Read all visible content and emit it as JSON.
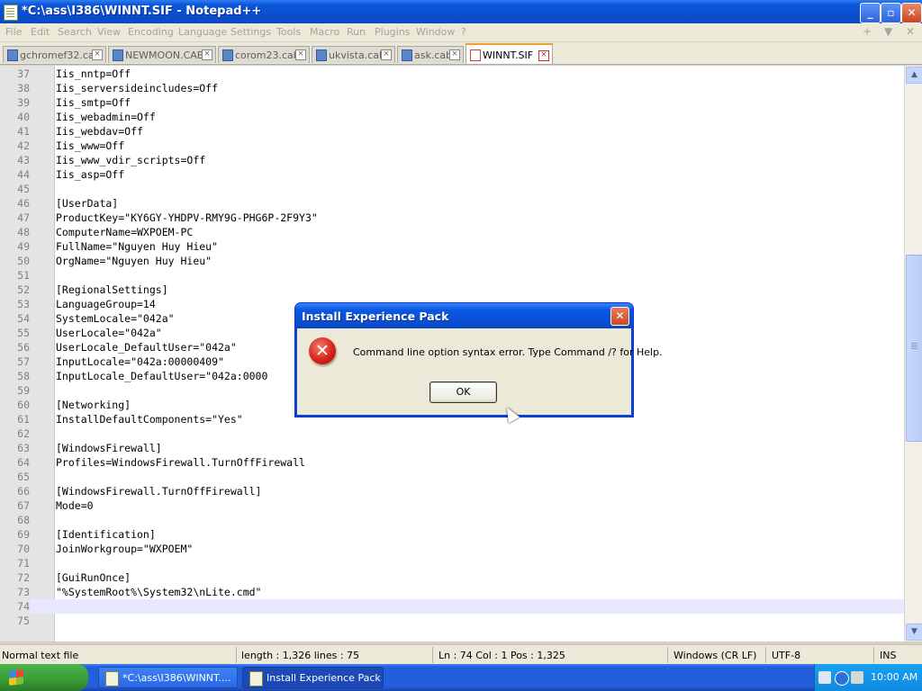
{
  "window": {
    "title": "*C:\\ass\\I386\\WINNT.SIF - Notepad++",
    "controls": {
      "minimize": "_",
      "maximize": "▫",
      "close": "✕"
    }
  },
  "menu": [
    "File",
    "Edit",
    "Search",
    "View",
    "Encoding",
    "Language",
    "Settings",
    "Tools",
    "Macro",
    "Run",
    "Plugins",
    "Window",
    "?"
  ],
  "menu_right": [
    "+",
    "▼",
    "✕"
  ],
  "tabs": [
    {
      "label": "gchromef32.cab",
      "active": false
    },
    {
      "label": "NEWMOON.CAB",
      "active": false
    },
    {
      "label": "corom23.cab",
      "active": false
    },
    {
      "label": "ukvista.cab",
      "active": false
    },
    {
      "label": "ask.cab",
      "active": false
    },
    {
      "label": "WINNT.SIF",
      "active": true
    }
  ],
  "editor": {
    "current_line": 74,
    "lines": [
      {
        "n": "37",
        "t": "Iis_nntp=Off"
      },
      {
        "n": "38",
        "t": "Iis_serversideincludes=Off"
      },
      {
        "n": "39",
        "t": "Iis_smtp=Off"
      },
      {
        "n": "40",
        "t": "Iis_webadmin=Off"
      },
      {
        "n": "41",
        "t": "Iis_webdav=Off"
      },
      {
        "n": "42",
        "t": "Iis_www=Off"
      },
      {
        "n": "43",
        "t": "Iis_www_vdir_scripts=Off"
      },
      {
        "n": "44",
        "t": "Iis_asp=Off"
      },
      {
        "n": "45",
        "t": ""
      },
      {
        "n": "46",
        "t": "[UserData]"
      },
      {
        "n": "47",
        "t": "ProductKey=\"KY6GY-YHDPV-RMY9G-PHG6P-2F9Y3\""
      },
      {
        "n": "48",
        "t": "ComputerName=WXPOEM-PC"
      },
      {
        "n": "49",
        "t": "FullName=\"Nguyen Huy Hieu\""
      },
      {
        "n": "50",
        "t": "OrgName=\"Nguyen Huy Hieu\""
      },
      {
        "n": "51",
        "t": ""
      },
      {
        "n": "52",
        "t": "[RegionalSettings]"
      },
      {
        "n": "53",
        "t": "LanguageGroup=14"
      },
      {
        "n": "54",
        "t": "SystemLocale=\"042a\""
      },
      {
        "n": "55",
        "t": "UserLocale=\"042a\""
      },
      {
        "n": "56",
        "t": "UserLocale_DefaultUser=\"042a\""
      },
      {
        "n": "57",
        "t": "InputLocale=\"042a:00000409\""
      },
      {
        "n": "58",
        "t": "InputLocale_DefaultUser=\"042a:0000"
      },
      {
        "n": "59",
        "t": ""
      },
      {
        "n": "60",
        "t": "[Networking]"
      },
      {
        "n": "61",
        "t": "InstallDefaultComponents=\"Yes\""
      },
      {
        "n": "62",
        "t": ""
      },
      {
        "n": "63",
        "t": "[WindowsFirewall]"
      },
      {
        "n": "64",
        "t": "Profiles=WindowsFirewall.TurnOffFirewall"
      },
      {
        "n": "65",
        "t": ""
      },
      {
        "n": "66",
        "t": "[WindowsFirewall.TurnOffFirewall]"
      },
      {
        "n": "67",
        "t": "Mode=0"
      },
      {
        "n": "68",
        "t": ""
      },
      {
        "n": "69",
        "t": "[Identification]"
      },
      {
        "n": "70",
        "t": "JoinWorkgroup=\"WXPOEM\""
      },
      {
        "n": "71",
        "t": ""
      },
      {
        "n": "72",
        "t": "[GuiRunOnce]"
      },
      {
        "n": "73",
        "t": "\"%SystemRoot%\\System32\\nLite.cmd\""
      },
      {
        "n": "74",
        "t": ""
      },
      {
        "n": "75",
        "t": ""
      }
    ]
  },
  "status": {
    "file_type": "Normal text file",
    "length": "length : 1,326    lines : 75",
    "position": "Ln : 74    Col : 1    Pos : 1,325",
    "eol": "Windows (CR LF)",
    "encoding": "UTF-8",
    "mode": "INS"
  },
  "dialog": {
    "title": "Install Experience Pack",
    "message": "Command line option syntax error. Type Command /? for Help.",
    "ok_label": "OK",
    "close": "✕",
    "error_glyph": "✕"
  },
  "taskbar": {
    "start_label": "start",
    "buttons": [
      {
        "label": "*C:\\ass\\I386\\WINNT....",
        "active": false
      },
      {
        "label": "Install Experience Pack",
        "active": true
      }
    ],
    "clock": "10:00 AM"
  },
  "colors": {
    "title_blue": "#0a4fd0",
    "current_line": "#e8e8ff",
    "error_red": "#d51f16",
    "tab_accent": "#f0a030"
  }
}
